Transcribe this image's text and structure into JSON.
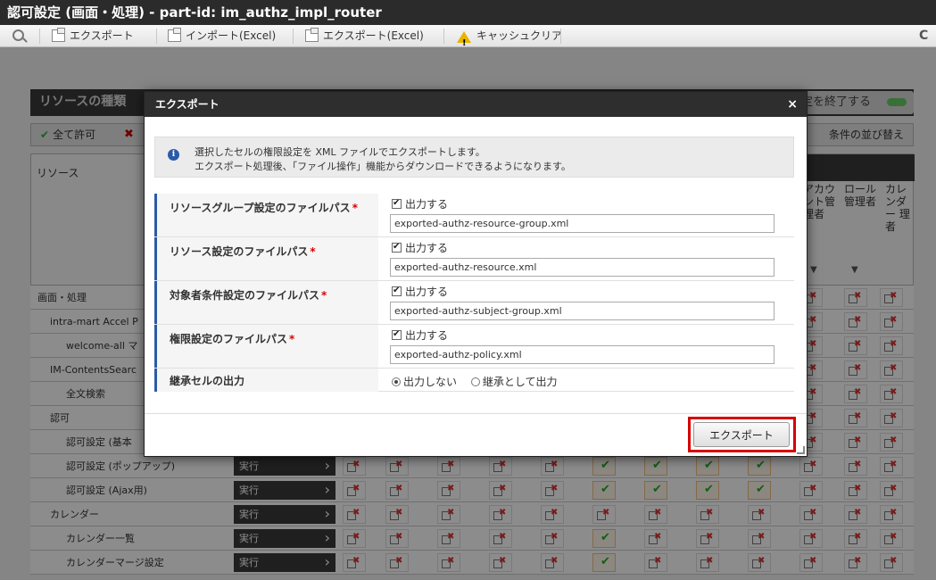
{
  "window": {
    "title": "認可設定 (画面・処理) - part-id: im_authz_impl_router"
  },
  "toolbar": {
    "export": "エクスポート",
    "import_excel": "インポート(Excel)",
    "export_excel": "エクスポート(Excel)",
    "cache_clear": "キャッシュクリア",
    "refresh_icon": "C"
  },
  "background": {
    "panel_title": "リソースの種類",
    "end_setting": "定を終了する",
    "allow_all": "全て許可",
    "sort_conditions": "条件の並び替え",
    "resource_header": "リソース",
    "col_account_admin": "アカウ ント管 理者",
    "col_role_admin": "ロール 管理者",
    "col_calendar_admin": "カレ ンダー 理者",
    "rows": [
      {
        "label": "画面・処理",
        "indent": 0
      },
      {
        "label": "intra-mart Accel P",
        "indent": 1
      },
      {
        "label": "welcome-all マ",
        "indent": 2
      },
      {
        "label": "IM-ContentsSearc",
        "indent": 1
      },
      {
        "label": "全文検索",
        "indent": 2
      },
      {
        "label": "認可",
        "indent": 1
      },
      {
        "label": "認可設定 (基本",
        "indent": 2
      },
      {
        "label": "認可設定 (ポップアップ)",
        "indent": 2,
        "action": "実行"
      },
      {
        "label": "認可設定 (Ajax用)",
        "indent": 2,
        "action": "実行"
      },
      {
        "label": "カレンダー",
        "indent": 1,
        "action": "実行"
      },
      {
        "label": "カレンダー一覧",
        "indent": 2,
        "action": "実行"
      },
      {
        "label": "カレンダーマージ設定",
        "indent": 2,
        "action": "実行"
      }
    ]
  },
  "modal": {
    "title": "エクスポート",
    "close_icon": "×",
    "info_line1": "選択したセルの権限設定を XML ファイルでエクスポートします。",
    "info_line2": "エクスポート処理後、「ファイル操作」機能からダウンロードできるようになります。",
    "required_mark": "*",
    "output_label": "出力する",
    "fields": [
      {
        "label": "リソースグループ設定のファイルパス",
        "value": "exported-authz-resource-group.xml"
      },
      {
        "label": "リソース設定のファイルパス",
        "value": "exported-authz-resource.xml"
      },
      {
        "label": "対象者条件設定のファイルパス",
        "value": "exported-authz-subject-group.xml"
      },
      {
        "label": "権限設定のファイルパス",
        "value": "exported-authz-policy.xml"
      }
    ],
    "inherit_label": "継承セルの出力",
    "inherit_options": [
      "出力しない",
      "継承として出力"
    ],
    "export_button": "エクスポート"
  },
  "colors": {
    "highlight": "#d60000",
    "accent": "#2b5aa8",
    "header": "#2e2e2e"
  }
}
